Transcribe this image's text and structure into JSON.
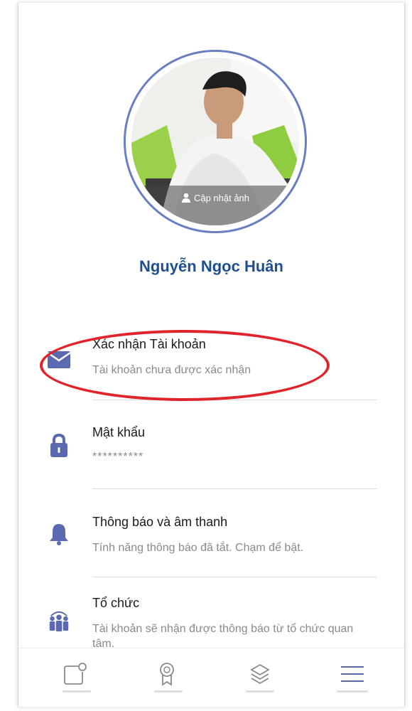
{
  "profile": {
    "name": "Nguyễn Ngọc Huân",
    "update_photo_label": "Cập nhật ảnh"
  },
  "menu": [
    {
      "title": "Xác nhận Tài khoản",
      "subtitle": "Tài khoản chưa được xác nhận",
      "icon": "envelope-icon"
    },
    {
      "title": "Mật khẩu",
      "subtitle": "**********",
      "icon": "lock-icon"
    },
    {
      "title": "Thông báo và âm thanh",
      "subtitle": "Tính năng thông báo đã tắt. Chạm để bật.",
      "icon": "bell-icon"
    },
    {
      "title": "Tổ chức",
      "subtitle": "Tài khoản sẽ nhận được thông báo từ tổ chức quan tâm.",
      "icon": "organization-icon"
    }
  ],
  "bottom_nav": [
    {
      "name": "new-post-icon"
    },
    {
      "name": "badge-icon"
    },
    {
      "name": "layers-icon"
    },
    {
      "name": "menu-icon"
    }
  ],
  "colors": {
    "accent": "#5b6ab0",
    "name_text": "#1f4f8f",
    "highlight": "#e0242b"
  }
}
